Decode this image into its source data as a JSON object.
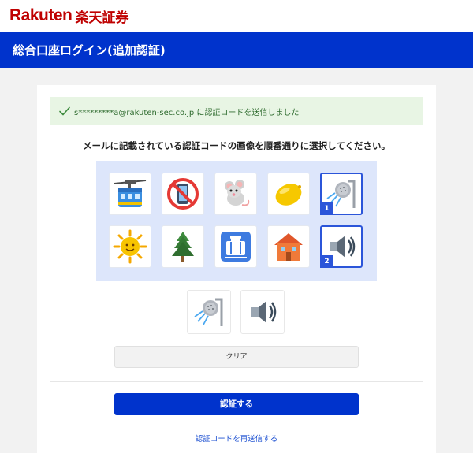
{
  "brand": {
    "latin": "Rakuten",
    "kanji": "楽天証券",
    "color": "#bf0000"
  },
  "header": {
    "title": "総合口座ログイン(追加認証)",
    "color": "#0033cc"
  },
  "notice": {
    "message": "s*********a@rakuten-sec.co.jp に認証コードを送信しました",
    "color": "#e8f5e4"
  },
  "instruction": "メールに記載されている認証コードの画像を順番通りに選択してください。",
  "grid": {
    "tiles": [
      {
        "icon": "ropeway-icon",
        "selected": false
      },
      {
        "icon": "no-mobile-phones-icon",
        "selected": false
      },
      {
        "icon": "mouse-icon",
        "selected": false
      },
      {
        "icon": "lemon-icon",
        "selected": false
      },
      {
        "icon": "shower-head-icon",
        "selected": true,
        "order": "1"
      },
      {
        "icon": "sun-with-face-icon",
        "selected": false
      },
      {
        "icon": "evergreen-tree-icon",
        "selected": false
      },
      {
        "icon": "baggage-claim-icon",
        "selected": false
      },
      {
        "icon": "house-icon",
        "selected": false
      },
      {
        "icon": "speaker-icon",
        "selected": true,
        "order": "2"
      }
    ]
  },
  "selected": [
    "shower-head-icon",
    "speaker-icon"
  ],
  "buttons": {
    "clear": "クリア",
    "authenticate": "認証する",
    "resend": "認証コードを再送信する"
  }
}
